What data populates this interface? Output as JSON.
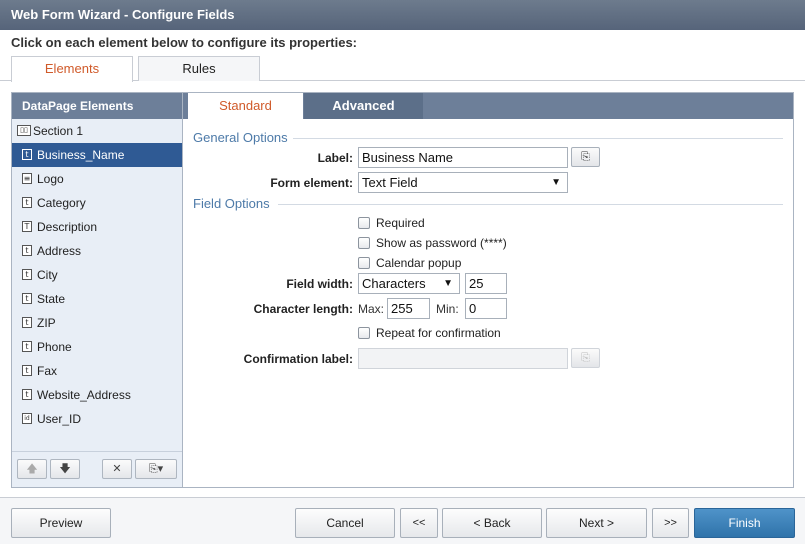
{
  "window": {
    "title": "Web Form Wizard - Configure Fields"
  },
  "instruction": "Click on each element below to configure its properties:",
  "top_tabs": [
    {
      "label": "Elements",
      "active": true
    },
    {
      "label": "Rules",
      "active": false
    }
  ],
  "sidebar": {
    "header": "DataPage Elements",
    "items": [
      {
        "label": "Section 1",
        "icon": "section-icon",
        "glyph": "▯▯"
      },
      {
        "label": "Business_Name",
        "icon": "text-field-icon",
        "glyph": "t",
        "selected": true
      },
      {
        "label": "Logo",
        "icon": "image-field-icon",
        "glyph": "≡"
      },
      {
        "label": "Category",
        "icon": "text-field-icon",
        "glyph": "t"
      },
      {
        "label": "Description",
        "icon": "text-area-icon",
        "glyph": "T"
      },
      {
        "label": "Address",
        "icon": "text-field-icon",
        "glyph": "t"
      },
      {
        "label": "City",
        "icon": "text-field-icon",
        "glyph": "t"
      },
      {
        "label": "State",
        "icon": "text-field-icon",
        "glyph": "t"
      },
      {
        "label": "ZIP",
        "icon": "text-field-icon",
        "glyph": "t"
      },
      {
        "label": "Phone",
        "icon": "text-field-icon",
        "glyph": "t"
      },
      {
        "label": "Fax",
        "icon": "text-field-icon",
        "glyph": "t"
      },
      {
        "label": "Website_Address",
        "icon": "text-field-icon",
        "glyph": "t"
      },
      {
        "label": "User_ID",
        "icon": "id-field-icon",
        "glyph": "id"
      }
    ],
    "toolbar": {
      "move_up": "🡅",
      "move_down": "🡇",
      "delete": "✕",
      "insert": "⎘▾"
    }
  },
  "main_tabs": [
    {
      "label": "Standard",
      "active": true
    },
    {
      "label": "Advanced",
      "active": false
    }
  ],
  "general_options": {
    "title": "General Options",
    "label_caption": "Label:",
    "label_value": "Business Name",
    "insert_button_glyph": "⎘",
    "form_element_caption": "Form element:",
    "form_element_value": "Text Field",
    "dropdown_arrow": "▼"
  },
  "field_options": {
    "title": "Field Options",
    "required": "Required",
    "show_as_password": "Show as password (****)",
    "calendar_popup": "Calendar popup",
    "field_width_caption": "Field width:",
    "field_width_unit": "Characters",
    "field_width_value": "25",
    "char_length_caption": "Character length:",
    "max_caption": "Max:",
    "max_value": "255",
    "min_caption": "Min:",
    "min_value": "0",
    "repeat_for_confirmation": "Repeat for confirmation",
    "confirmation_label_caption": "Confirmation label:",
    "confirmation_label_value": ""
  },
  "footer": {
    "preview": "Preview",
    "cancel": "Cancel",
    "first": "<<",
    "back": "< Back",
    "next": "Next >",
    "last": ">>",
    "finish": "Finish"
  },
  "colors": {
    "accent_tab_text": "#d05a2a",
    "selected_item": "#2f5a94",
    "header_bar": "#6d7f99",
    "finish_button": "#2f73aa",
    "section_title": "#4d7aa8"
  }
}
